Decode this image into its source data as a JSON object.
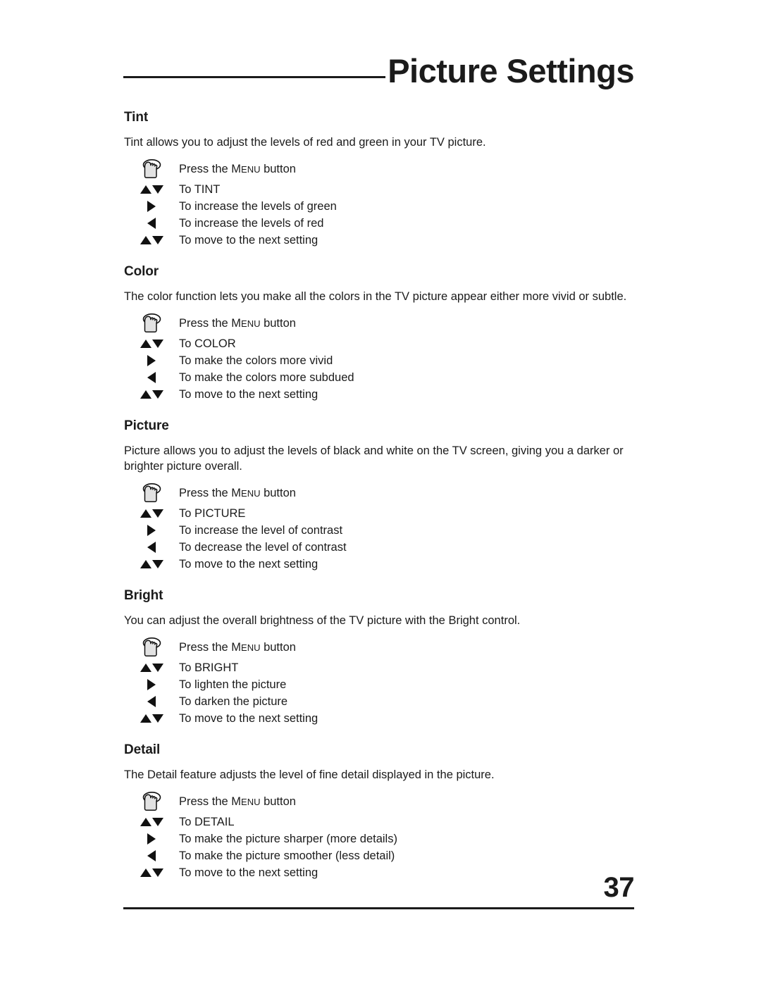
{
  "header": {
    "title": "Picture Settings",
    "rule_color": "#1b1b1b"
  },
  "footer": {
    "page_number": "37"
  },
  "glyphs": {
    "press_icon": "hand-press-button-icon",
    "updown": "up-down-arrows-icon",
    "right": "right-arrow-icon",
    "left": "left-arrow-icon"
  },
  "common": {
    "press_menu_prefix": "Press the ",
    "menu_lead": "M",
    "menu_rest": "ENU",
    "press_menu_suffix": " button",
    "next_setting": "To move to the next setting"
  },
  "sections": [
    {
      "title": "Tint",
      "description": "Tint allows you to adjust the levels of red and green in your TV picture.",
      "select": "To TINT",
      "increase": "To increase the levels of green",
      "decrease": "To increase the levels of red"
    },
    {
      "title": "Color",
      "description": "The color function lets you make all the colors in the TV picture appear either more vivid or subtle.",
      "select": "To COLOR",
      "increase": "To make the colors more vivid",
      "decrease": "To make the colors more subdued"
    },
    {
      "title": "Picture",
      "description": "Picture allows you to adjust the levels of black and white on the TV screen, giving you a darker or brighter picture overall.",
      "select": "To PICTURE",
      "increase": "To increase the level of contrast",
      "decrease": "To decrease the level of contrast"
    },
    {
      "title": "Bright",
      "description": "You can adjust the overall brightness of the TV picture with the Bright control.",
      "select": "To BRIGHT",
      "increase": "To lighten the picture",
      "decrease": "To darken the picture"
    },
    {
      "title": "Detail",
      "description": "The Detail feature adjusts the level of fine detail displayed in the picture.",
      "select": "To DETAIL",
      "increase": "To make the picture sharper (more details)",
      "decrease": "To make the picture smoother (less detail)"
    }
  ]
}
